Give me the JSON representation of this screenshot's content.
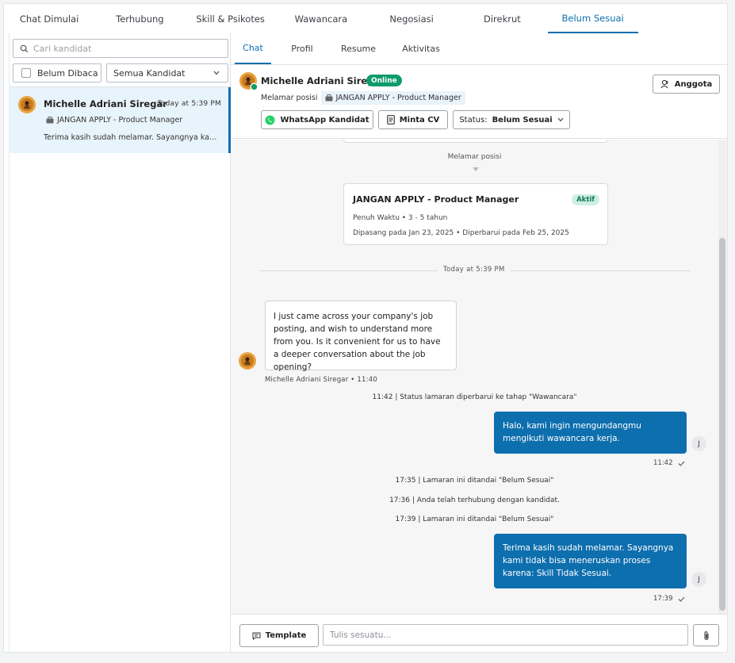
{
  "stage_tabs": [
    "Chat Dimulai",
    "Terhubung",
    "Skill & Psikotes",
    "Wawancara",
    "Negosiasi",
    "Direkrut",
    "Belum Sesuai"
  ],
  "left_panel": {
    "search_placeholder": "Cari kandidat",
    "unread_filter": "Belum Dibaca",
    "candidate_filter": "Semua Kandidat",
    "candidate": {
      "name": "Michelle Adriani Siregar",
      "time": "Today at 5:39 PM",
      "job": "JANGAN APPLY - Product Manager",
      "last_message": "Terima kasih sudah melamar. Sayangnya kami tidak bisa meneruskan proses karena: Skill Tidak Sesuai."
    }
  },
  "sub_tabs": [
    "Chat",
    "Profil",
    "Resume",
    "Aktivitas"
  ],
  "header": {
    "name": "Michelle Adriani Siregar",
    "online_label": "Online",
    "apply_prefix": "Melamar posisi",
    "job": "JANGAN APPLY - Product Manager",
    "whatsapp_label": "WhatsApp Kandidat",
    "cv_label": "Minta CV",
    "status_prefix": "Status:",
    "status_value": "Belum Sesuai",
    "members_label": "Anggota"
  },
  "chat": {
    "applied_label": "Melamar posisi",
    "job_card": {
      "title": "JANGAN APPLY - Product Manager",
      "badge": "Aktif",
      "meta": "Penuh Waktu • 3 - 5 tahun",
      "dates": "Dipasang pada Jan 23, 2025 • Diperbarui pada Feb 25, 2025"
    },
    "divider_time": "Today at 5:39 PM",
    "incoming": {
      "text": "I just came across your company's job posting, and wish to understand more from you. Is it convenient for us to have a deeper conversation about the job opening?",
      "meta": "Michelle Adriani Siregar • 11:40"
    },
    "system_1": "11:42 | Status lamaran diperbarui ke tahap \"Wawancara\"",
    "outgoing_1": {
      "text": "Halo, kami ingin mengundangmu mengikuti wawancara kerja.",
      "time": "11:42"
    },
    "system_2": "17:35 | Lamaran ini ditandai \"Belum Sesuai\"",
    "system_3": "17:36 | Anda telah terhubung dengan kandidat.",
    "system_4": "17:39 | Lamaran ini ditandai \"Belum Sesuai\"",
    "outgoing_2": {
      "text": "Terima kasih sudah melamar. Sayangnya kami tidak bisa meneruskan proses karena: Skill Tidak Sesuai.",
      "time": "17:39"
    },
    "recruiter_initial": "J"
  },
  "composer": {
    "template_label": "Template",
    "placeholder": "Tulis sesuatu..."
  },
  "colors": {
    "accent": "#0e6fae",
    "online": "#0f9b6c",
    "active_badge_bg": "#cfeee1",
    "whatsapp": "#25d366"
  }
}
